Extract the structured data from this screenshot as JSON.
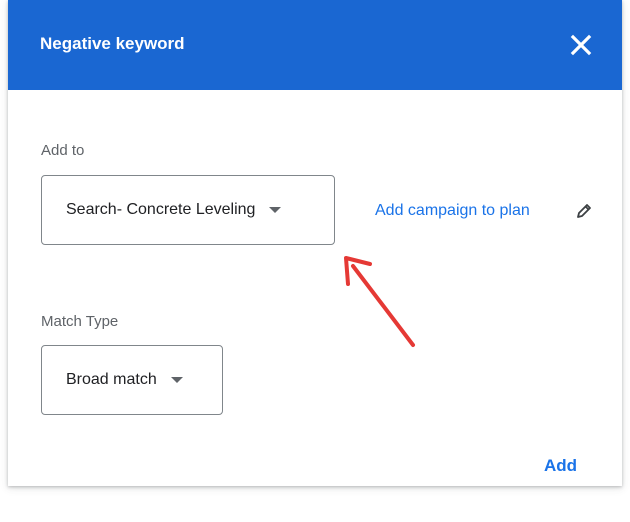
{
  "dialog": {
    "title": "Negative keyword",
    "close_icon": "close-icon"
  },
  "add_to": {
    "label": "Add to",
    "selected": "Search- Concrete Leveling",
    "add_campaign_link": "Add campaign to plan",
    "edit_icon": "pencil-icon"
  },
  "match_type": {
    "label": "Match Type",
    "selected": "Broad match"
  },
  "actions": {
    "add_label": "Add"
  },
  "colors": {
    "header": "#1a67d2",
    "link": "#1a73e8",
    "annotation_arrow": "#e53935"
  }
}
